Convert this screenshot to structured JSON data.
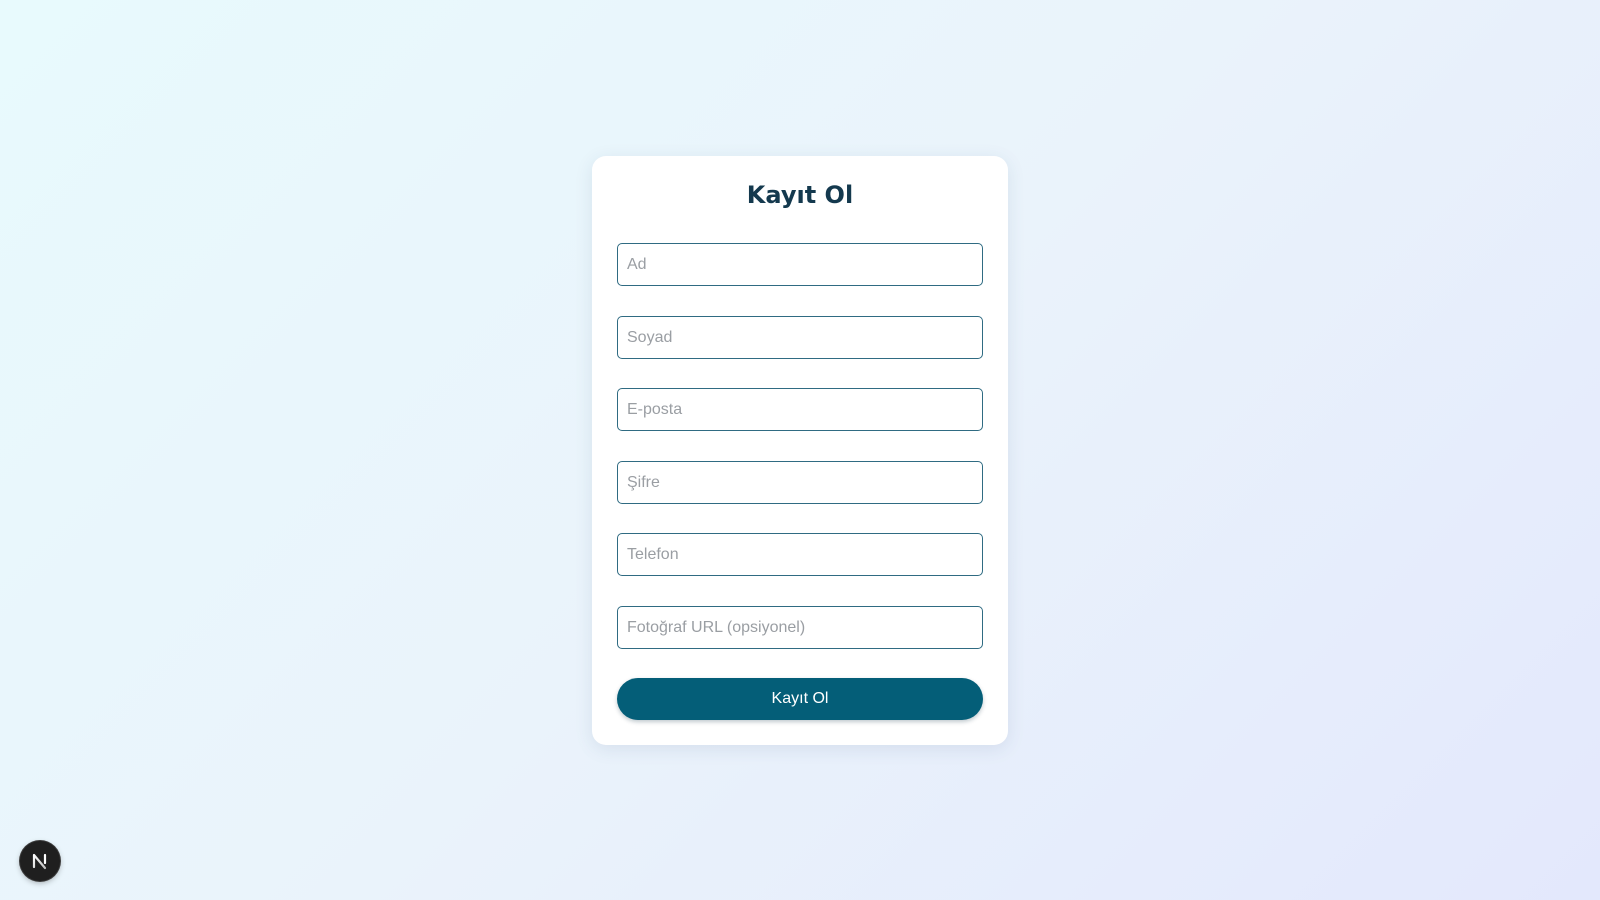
{
  "form": {
    "title": "Kayıt Ol",
    "fields": [
      {
        "name": "first-name",
        "placeholder": "Ad",
        "value": ""
      },
      {
        "name": "last-name",
        "placeholder": "Soyad",
        "value": ""
      },
      {
        "name": "email",
        "placeholder": "E-posta",
        "value": ""
      },
      {
        "name": "password",
        "placeholder": "Şifre",
        "value": ""
      },
      {
        "name": "phone",
        "placeholder": "Telefon",
        "value": ""
      },
      {
        "name": "photo-url",
        "placeholder": "Fotoğraf URL (opsiyonel)",
        "value": ""
      }
    ],
    "submit_label": "Kayıt Ol"
  },
  "dev_badge": {
    "icon": "nextjs-logo-icon",
    "letter": "N"
  },
  "colors": {
    "title": "#14394e",
    "input_border": "#2f6b82",
    "button_bg": "#045e78",
    "button_text": "#ffffff",
    "badge_bg": "#1f1f1f"
  }
}
